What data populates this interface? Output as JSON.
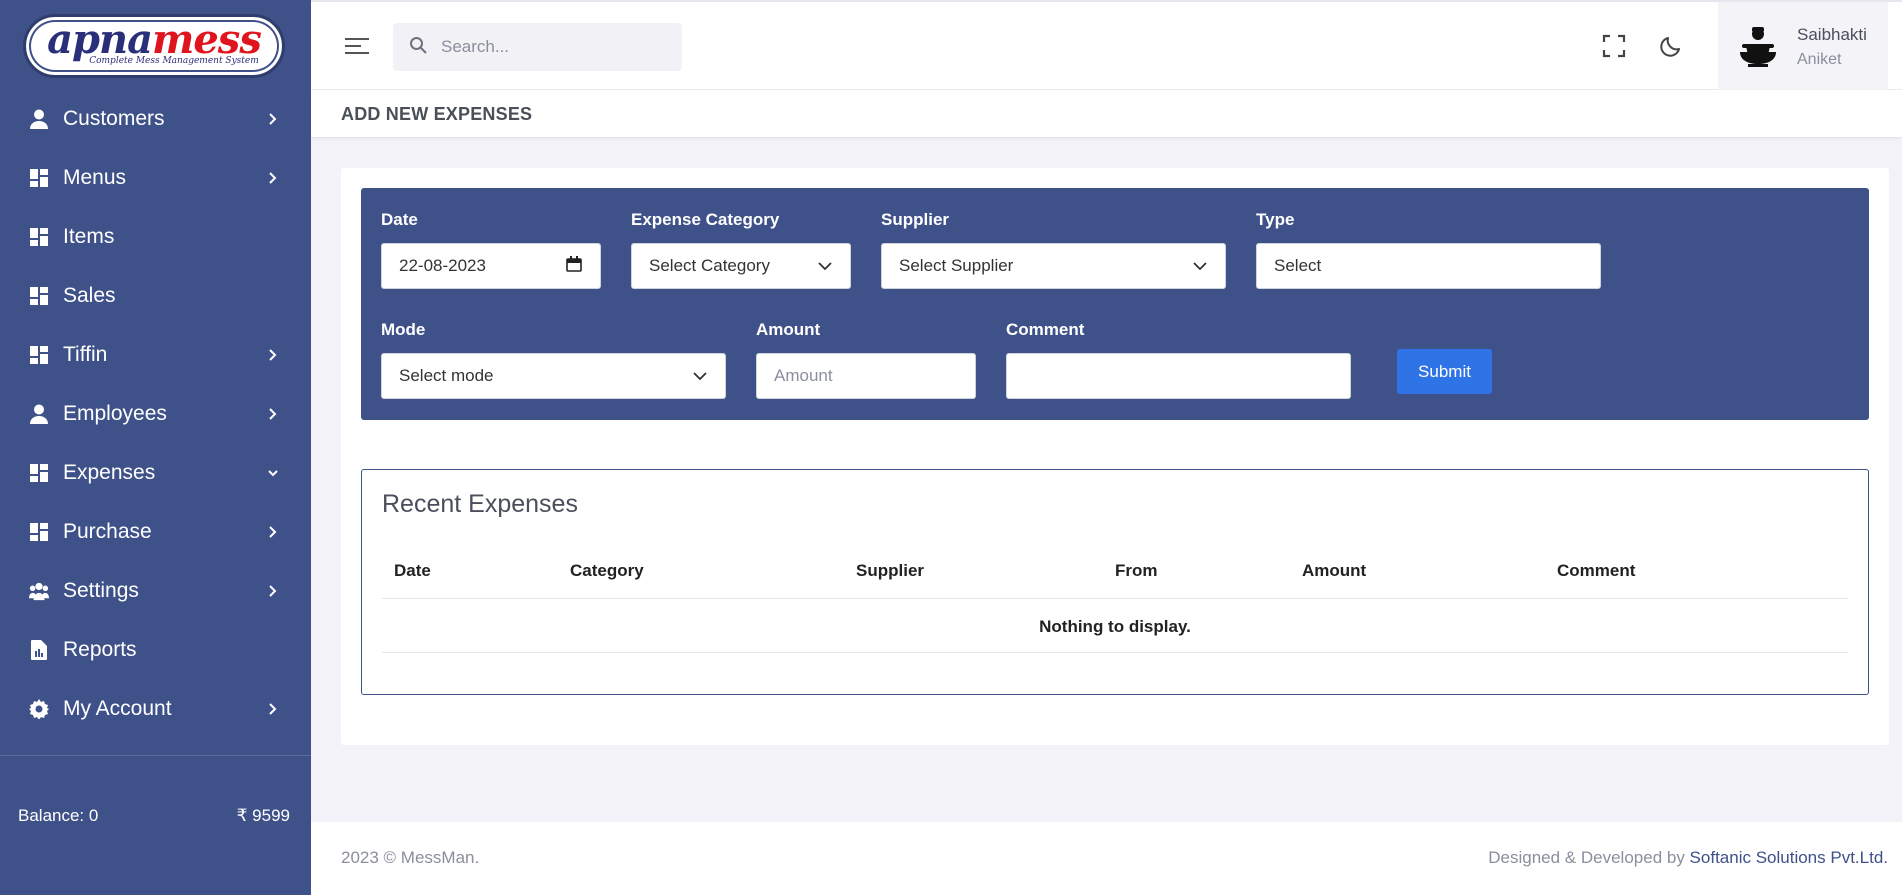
{
  "brand": {
    "logo_part1": "apna",
    "logo_part2": "mess",
    "tagline": "Complete Mess Management System"
  },
  "sidebar": {
    "items": [
      {
        "label": "Customers",
        "icon": "user-icon",
        "chevron": "right"
      },
      {
        "label": "Menus",
        "icon": "dashboard-icon",
        "chevron": "right"
      },
      {
        "label": "Items",
        "icon": "dashboard-icon",
        "chevron": ""
      },
      {
        "label": "Sales",
        "icon": "dashboard-icon",
        "chevron": ""
      },
      {
        "label": "Tiffin",
        "icon": "dashboard-icon",
        "chevron": "right"
      },
      {
        "label": "Employees",
        "icon": "user-icon",
        "chevron": "right"
      },
      {
        "label": "Expenses",
        "icon": "dashboard-icon",
        "chevron": "down"
      },
      {
        "label": "Purchase",
        "icon": "dashboard-icon",
        "chevron": "right"
      },
      {
        "label": "Settings",
        "icon": "users-icon",
        "chevron": "right"
      },
      {
        "label": "Reports",
        "icon": "report-icon",
        "chevron": ""
      },
      {
        "label": "My Account",
        "icon": "gear-icon",
        "chevron": "right"
      }
    ],
    "balance_label": "Balance: 0",
    "balance_amount": "₹ 9599"
  },
  "header": {
    "search_placeholder": "Search...",
    "user_name": "Saibhakti",
    "user_role": "Aniket"
  },
  "page": {
    "title": "ADD NEW EXPENSES"
  },
  "form": {
    "date_label": "Date",
    "date_value": "22-08-2023",
    "category_label": "Expense Category",
    "category_value": "Select Category",
    "supplier_label": "Supplier",
    "supplier_value": "Select Supplier",
    "type_label": "Type",
    "type_value": "Select",
    "mode_label": "Mode",
    "mode_value": "Select mode",
    "amount_label": "Amount",
    "amount_placeholder": "Amount",
    "comment_label": "Comment",
    "comment_value": "",
    "submit_label": "Submit"
  },
  "recent": {
    "title": "Recent Expenses",
    "columns": [
      "Date",
      "Category",
      "Supplier",
      "From",
      "Amount",
      "Comment"
    ],
    "rows": [],
    "empty_text": "Nothing to display."
  },
  "footer": {
    "copyright": "2023 © MessMan.",
    "credit_prefix": "Designed & Developed by ",
    "credit_company": "Softanic Solutions Pvt.Ltd."
  },
  "colors": {
    "sidebar": "#3f5189",
    "accent": "#2f74e6",
    "background": "#f2f2f8"
  }
}
